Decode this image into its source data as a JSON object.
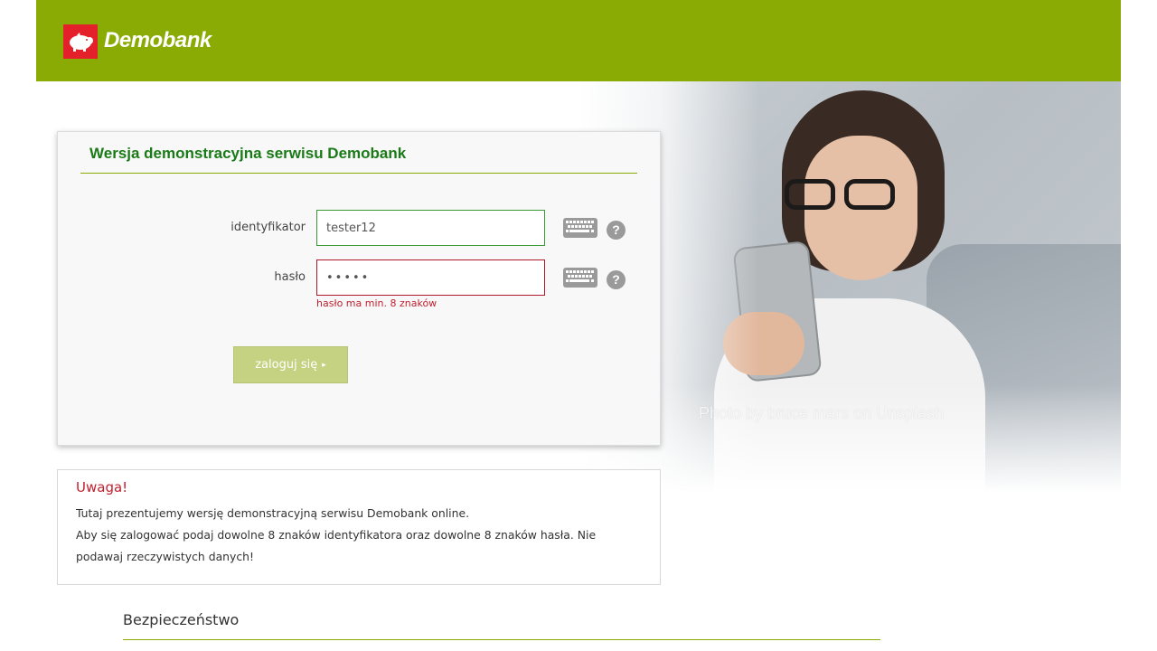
{
  "header": {
    "brand": "Demobank",
    "logo_icon": "pig-logo-icon",
    "bg_color": "#8aab04",
    "logo_color": "#e4202a"
  },
  "hero": {
    "photo_credit": "Photo by bruce mars on Unsplash"
  },
  "login_panel": {
    "title": "Wersja demonstracyjna serwisu Demobank",
    "id_label": "identyfikator",
    "id_value": "tester12",
    "password_label": "hasło",
    "password_value": "•••••",
    "password_error": "hasło ma min. 8 znaków",
    "login_button": "zaloguj się",
    "keyboard_icon": "virtual-keyboard-icon",
    "help_icon": "help-icon",
    "help_glyph": "?",
    "error_color": "#c0212f",
    "title_color": "#1a7a17"
  },
  "notice": {
    "title": "Uwaga!",
    "line1": "Tutaj prezentujemy wersję demonstracyjną serwisu Demobank online.",
    "line2": "Aby się zalogować podaj dowolne 8 znaków identyfikatora oraz dowolne 8 znaków hasła. Nie podawaj rzeczywistych danych!"
  },
  "security": {
    "title": "Bezpieczeństwo"
  }
}
